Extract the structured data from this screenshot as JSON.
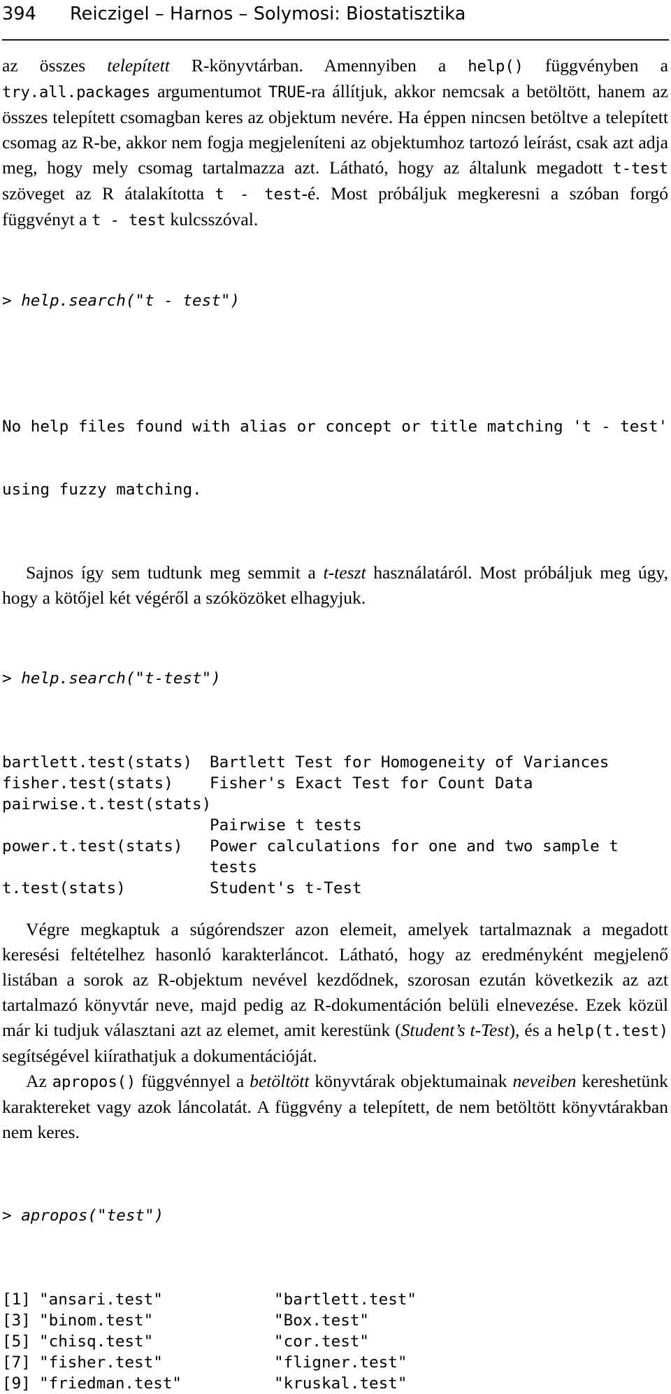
{
  "header": {
    "page_number": "394",
    "running_title": "Reiczigel – Harnos – Solymosi: Biostatisztika"
  },
  "paragraphs": {
    "p1": {
      "seg1": "az összes ",
      "seg2_italic": "telepített",
      "seg3": " R-könyvtárban. Amennyiben a ",
      "seg4_code": "help()",
      "seg5": " függvényben a ",
      "seg6_code": "try.all.packages",
      "seg7": " argumentumot ",
      "seg8_code": "TRUE",
      "seg9": "-ra állítjuk, akkor nemcsak a betöltött, hanem az összes telepített csomagban keres az objektum nevére. Ha éppen nincsen betöltve a telepített csomag az R-be, akkor nem fogja megjeleníteni az objektumhoz tartozó leírást, csak azt adja meg, hogy mely csomag tartalmazza azt. Látható, hogy az általunk megadott ",
      "seg10_code": "t-test",
      "seg11": " szöveget az R átalakította ",
      "seg12_code": "t - test",
      "seg13": "-é. Most próbáljuk megkeresni a szóban forgó függvényt a ",
      "seg14_code": "t - test",
      "seg15": " kulcsszóval."
    },
    "p2": {
      "seg1": "Sajnos így sem tudtunk meg semmit a ",
      "seg2_italic": "t-teszt",
      "seg3": " használatáról. Most próbáljuk meg úgy, hogy a kötőjel két végéről a szóközöket elhagyjuk."
    },
    "p3": {
      "seg1": "Végre megkaptuk a súgórendszer azon elemeit, amelyek tartalmaznak a megadott keresési feltételhez hasonló karakterláncot. Látható, hogy az eredményként megjelenő listában a sorok az R-objektum nevével kezdődnek, szorosan ezután következik az azt tartalmazó könyvtár neve, majd pedig az R-dokumentáción belüli elnevezése. Ezek közül már ki tudjuk választani azt az elemet, amit kerestünk (",
      "seg2_italic": "Student’s t-Test",
      "seg3": "), és a ",
      "seg4_code": "help(t.test)",
      "seg5": " segítségével kiírathatjuk a dokumentációját."
    },
    "p4": {
      "seg1": "Az ",
      "seg2_code": "apropos()",
      "seg3": " függvénnyel a ",
      "seg4_italic": "betöltött",
      "seg5": " könyvtárak objektumainak ",
      "seg6_italic": "neveiben",
      "seg7": " kereshetünk karaktereket vagy azok láncolatát. A függvény a telepített, de nem betöltött könyvtárakban nem keres."
    }
  },
  "code_blocks": {
    "input1": "> help.search(\"t - test\")",
    "output1_line1": "No help files found with alias or concept or title matching 't - test'",
    "output1_line2": "using fuzzy matching.",
    "input2": "> help.search(\"t-test\")",
    "input3": "> apropos(\"test\")"
  },
  "help_search_results": [
    {
      "name": "bartlett.test(stats)",
      "description": "Bartlett Test for Homogeneity of Variances"
    },
    {
      "name": "fisher.test(stats)",
      "description": "Fisher's Exact Test for Count Data"
    },
    {
      "name": "pairwise.t.test(stats)",
      "description": ""
    },
    {
      "name": "",
      "description": "Pairwise t tests"
    },
    {
      "name": "power.t.test(stats)",
      "description": "Power calculations for one and two sample t"
    },
    {
      "name": "",
      "description": "tests"
    },
    {
      "name": "t.test(stats)",
      "description": "Student's t-Test"
    }
  ],
  "apropos_results": [
    {
      "index": "[1]",
      "col1": "\"ansari.test\"",
      "col2": "\"bartlett.test\""
    },
    {
      "index": "[3]",
      "col1": "\"binom.test\"",
      "col2": "\"Box.test\""
    },
    {
      "index": "[5]",
      "col1": "\"chisq.test\"",
      "col2": "\"cor.test\""
    },
    {
      "index": "[7]",
      "col1": "\"fisher.test\"",
      "col2": "\"fligner.test\""
    },
    {
      "index": "[9]",
      "col1": "\"friedman.test\"",
      "col2": "\"kruskal.test\""
    }
  ]
}
